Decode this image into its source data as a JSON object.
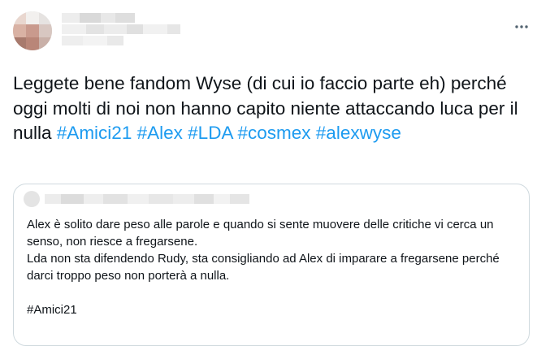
{
  "tweet": {
    "text_before": "Leggete bene fandom Wyse (di cui io faccio parte eh) perché oggi molti di noi non hanno capito niente attaccando luca per il nulla ",
    "hashtags": [
      "#Amici21",
      "#Alex",
      "#LDA",
      "#cosmex",
      "#alexwyse"
    ],
    "more_icon": "more-horizontal-icon"
  },
  "quote": {
    "text": "Alex è solito dare peso alle parole e quando si sente muovere delle critiche vi cerca un senso, non riesce a fregarsene.\nLda non sta difendendo Rudy, sta consigliando ad Alex di imparare a fregarsene perché darci troppo peso non porterà a nulla.\n\n#Amici21"
  },
  "colors": {
    "text": "#0f1419",
    "link": "#1d9bf0",
    "border": "#cfd9de",
    "icon": "#536471"
  }
}
